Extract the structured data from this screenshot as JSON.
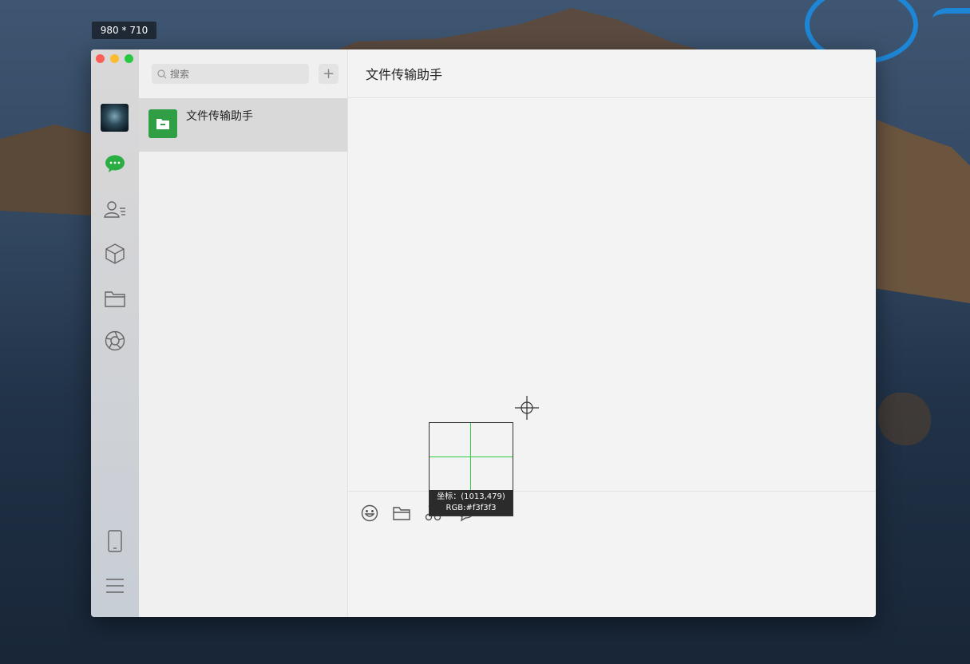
{
  "size_badge": "980 * 710",
  "sidebar": {
    "icons": [
      "avatar",
      "chat-icon",
      "contacts-icon",
      "cube-icon",
      "folder-icon",
      "aperture-icon",
      "phone-icon",
      "menu-icon"
    ]
  },
  "search": {
    "placeholder": "搜索",
    "add_label": "+"
  },
  "chats": [
    {
      "name": "文件传输助手",
      "icon": "folder-icon"
    }
  ],
  "conversation": {
    "title": "文件传输助手"
  },
  "composer": {
    "tools": [
      "emoji-icon",
      "folder-icon",
      "scissors-icon",
      "chat-bubble-icon"
    ]
  },
  "color_picker": {
    "coord_text": "坐标：(1013,479)",
    "rgb_text": "RGB:#f3f3f3"
  },
  "colors": {
    "accent_green": "#2f9e44",
    "window_bg": "#f3f3f3",
    "selected_item": "#d9d9d9",
    "logo_blue": "#1e86d6"
  }
}
